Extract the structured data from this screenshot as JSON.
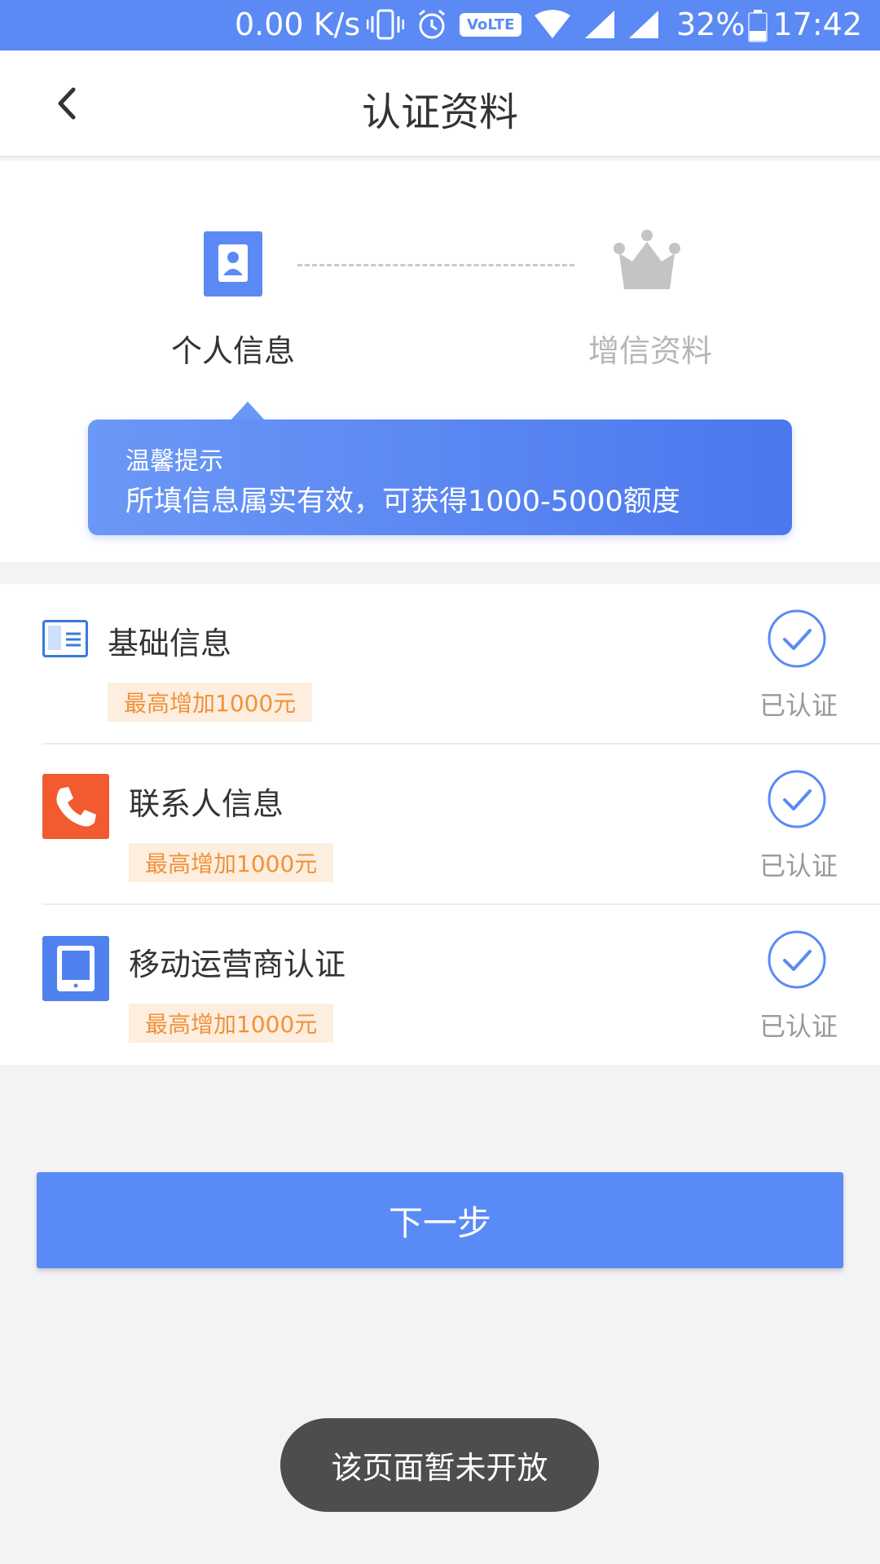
{
  "status_bar": {
    "speed": "0.00 K/s",
    "network_badge": "VoLTE",
    "battery": "32%",
    "time": "17:42",
    "icons": [
      "vibrate-icon",
      "alarm-icon",
      "volte-icon",
      "wifi-icon",
      "signal-icon",
      "signal-icon",
      "battery-icon"
    ]
  },
  "nav": {
    "title": "认证资料",
    "back_icon": "chevron-left-icon"
  },
  "steps": [
    {
      "label": "个人信息",
      "icon": "person-card-icon",
      "active": true
    },
    {
      "label": "增信资料",
      "icon": "crown-icon",
      "active": false
    }
  ],
  "tip": {
    "title": "温馨提示",
    "text": "所填信息属实有效，可获得1000-5000额度"
  },
  "items": [
    {
      "title": "基础信息",
      "badge": "最高增加1000元",
      "status": "已认证",
      "icon": "id-card-icon"
    },
    {
      "title": "联系人信息",
      "badge": "最高增加1000元",
      "status": "已认证",
      "icon": "phone-icon"
    },
    {
      "title": "移动运营商认证",
      "badge": "最高增加1000元",
      "status": "已认证",
      "icon": "mobile-device-icon"
    }
  ],
  "next_button": "下一步",
  "toast": "该页面暂未开放",
  "colors": {
    "primary": "#5b8af5",
    "badge_text": "#f0923b",
    "badge_bg": "#fdeedf",
    "phone_icon": "#f25a30"
  }
}
